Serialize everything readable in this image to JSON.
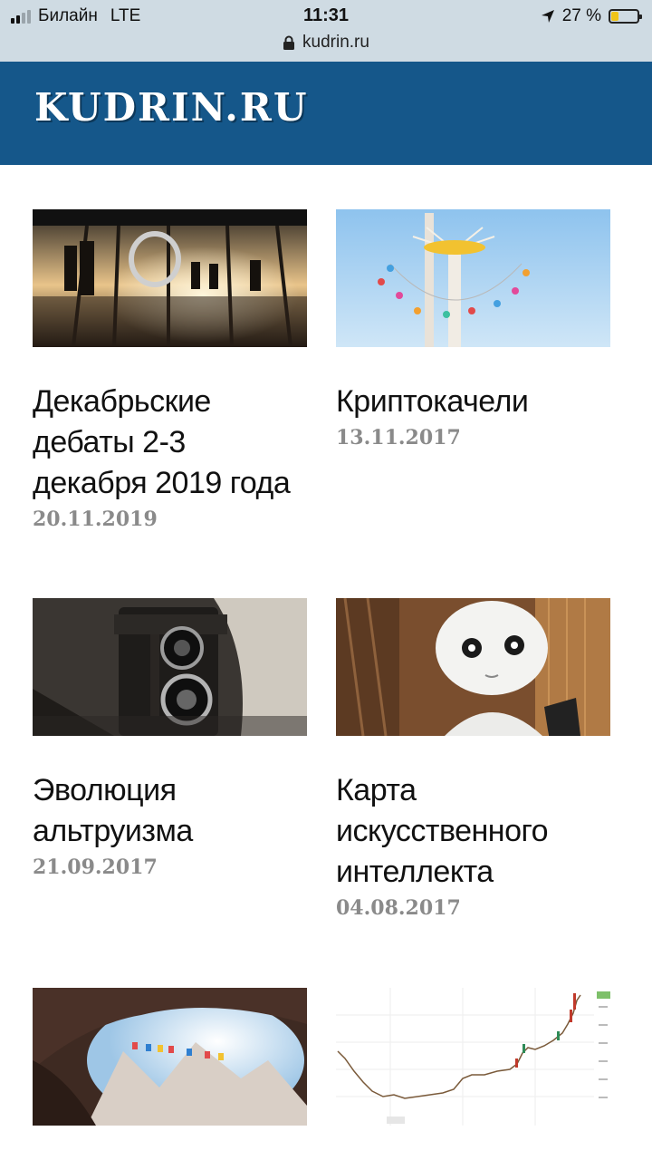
{
  "status_bar": {
    "carrier": "Билайн",
    "network": "LTE",
    "time": "11:31",
    "battery_text": "27 %",
    "battery_level": 0.27,
    "url": "kudrin.ru"
  },
  "site": {
    "logo": "KUDRIN.RU",
    "header_color": "#15578a"
  },
  "articles": [
    {
      "title": "Декабрьские дебаты 2-3 декабря 2019 года",
      "date": "20.11.2019",
      "image": "conference-photo"
    },
    {
      "title": "Криптокачели",
      "date": "13.11.2017",
      "image": "swing-ride-photo"
    },
    {
      "title": "Эволюция альтруизма",
      "date": "21.09.2017",
      "image": "vintage-camera-photo"
    },
    {
      "title": "Карта искусственного интеллекта",
      "date": "04.08.2017",
      "image": "robot-photo"
    },
    {
      "title": "",
      "date": "",
      "image": "cave-flags-photo"
    },
    {
      "title": "",
      "date": "",
      "image": "price-chart-image"
    }
  ]
}
